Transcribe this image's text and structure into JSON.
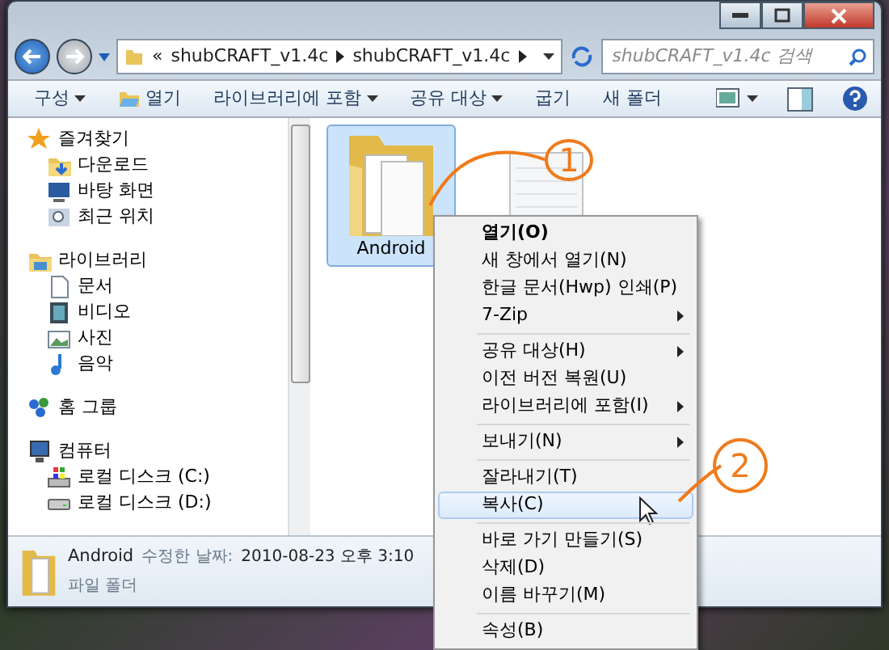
{
  "address_bar": {
    "overflow": "«",
    "crumbs": [
      "shubCRAFT_v1.4c",
      "shubCRAFT_v1.4c"
    ]
  },
  "search": {
    "placeholder": "shubCRAFT_v1.4c 검색"
  },
  "toolbar": [
    {
      "label": "구성",
      "dropdown": true,
      "icon": false
    },
    {
      "label": "열기",
      "dropdown": false,
      "icon": true
    },
    {
      "label": "라이브러리에 포함",
      "dropdown": true,
      "icon": false
    },
    {
      "label": "공유 대상",
      "dropdown": true,
      "icon": false
    },
    {
      "label": "굽기",
      "dropdown": false,
      "icon": false
    },
    {
      "label": "새 폴더",
      "dropdown": false,
      "icon": false
    }
  ],
  "sidebar": {
    "groups": [
      {
        "label": "즐겨찾기",
        "children": [
          {
            "label": "다운로드"
          },
          {
            "label": "바탕 화면"
          },
          {
            "label": "최근 위치"
          }
        ]
      },
      {
        "label": "라이브러리",
        "children": [
          {
            "label": "문서"
          },
          {
            "label": "비디오"
          },
          {
            "label": "사진"
          },
          {
            "label": "음악"
          }
        ]
      },
      {
        "label": "홈 그룹"
      },
      {
        "label": "컴퓨터",
        "children": [
          {
            "label": "로컬 디스크 (C:)"
          },
          {
            "label": "로컬 디스크 (D:)"
          }
        ]
      }
    ]
  },
  "files": [
    {
      "name": "Android",
      "kind": "folder",
      "selected": true
    },
    {
      "kind": "notepad",
      "selected": false
    }
  ],
  "context_menu": [
    {
      "kind": "item",
      "label": "열기(O)",
      "default": true,
      "submenu": false,
      "selected": false
    },
    {
      "kind": "item",
      "label": "새 창에서 열기(N)",
      "default": false,
      "submenu": false,
      "selected": false
    },
    {
      "kind": "item",
      "label": "한글 문서(Hwp) 인쇄(P)",
      "default": false,
      "submenu": false,
      "selected": false
    },
    {
      "kind": "item",
      "label": "7-Zip",
      "default": false,
      "submenu": true,
      "selected": false
    },
    {
      "kind": "separator"
    },
    {
      "kind": "item",
      "label": "공유 대상(H)",
      "default": false,
      "submenu": true,
      "selected": false
    },
    {
      "kind": "item",
      "label": "이전 버전 복원(U)",
      "default": false,
      "submenu": false,
      "selected": false
    },
    {
      "kind": "item",
      "label": "라이브러리에 포함(I)",
      "default": false,
      "submenu": true,
      "selected": false
    },
    {
      "kind": "separator"
    },
    {
      "kind": "item",
      "label": "보내기(N)",
      "default": false,
      "submenu": true,
      "selected": false
    },
    {
      "kind": "separator"
    },
    {
      "kind": "item",
      "label": "잘라내기(T)",
      "default": false,
      "submenu": false,
      "selected": false
    },
    {
      "kind": "item",
      "label": "복사(C)",
      "default": false,
      "submenu": false,
      "selected": true
    },
    {
      "kind": "separator"
    },
    {
      "kind": "item",
      "label": "바로 가기 만들기(S)",
      "default": false,
      "submenu": false,
      "selected": false
    },
    {
      "kind": "item",
      "label": "삭제(D)",
      "default": false,
      "submenu": false,
      "selected": false
    },
    {
      "kind": "item",
      "label": "이름 바꾸기(M)",
      "default": false,
      "submenu": false,
      "selected": false
    },
    {
      "kind": "separator"
    },
    {
      "kind": "item",
      "label": "속성(B)",
      "default": false,
      "submenu": false,
      "selected": false
    }
  ],
  "details": {
    "name": "Android",
    "date_label": "수정한 날짜:",
    "date": "2010-08-23 오후 3:10",
    "type": "파일 폴더"
  },
  "annotations": [
    {
      "label": "1"
    },
    {
      "label": "2"
    }
  ]
}
